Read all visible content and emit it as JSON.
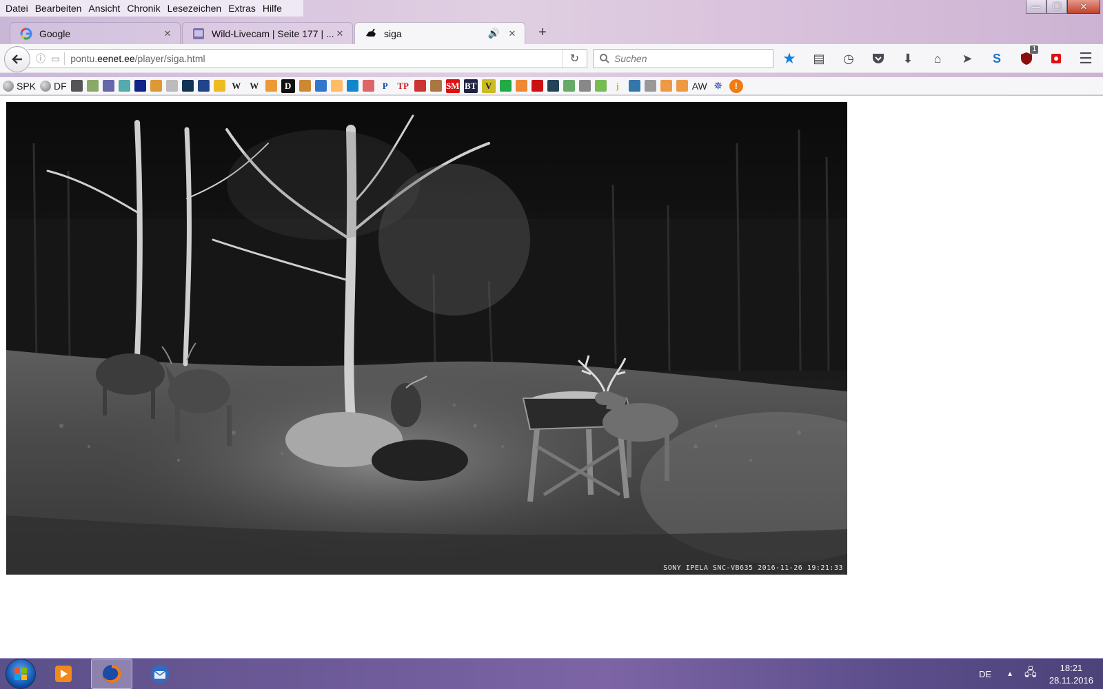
{
  "menubar": {
    "items": [
      "Datei",
      "Bearbeiten",
      "Ansicht",
      "Chronik",
      "Lesezeichen",
      "Extras",
      "Hilfe"
    ]
  },
  "window_controls": {
    "minimize": "—",
    "maximize": "❐",
    "close": "✕"
  },
  "tabs": [
    {
      "title": "Google",
      "favicon": "google-icon",
      "active": false
    },
    {
      "title": "Wild-Livecam | Seite 177 | ...",
      "favicon": "forum-icon",
      "active": false
    },
    {
      "title": "siga",
      "favicon": "boar-icon",
      "active": true,
      "audio": true
    }
  ],
  "new_tab_label": "+",
  "navbar": {
    "url_prefix": "pontu.",
    "url_host": "eenet.ee",
    "url_path": "/player/siga.html",
    "search_placeholder": "Suchen",
    "addon_badge": "1"
  },
  "bookmarks": {
    "spk": "SPK",
    "df": "DF",
    "aw": "AW",
    "icons": [
      "ob",
      "dgf",
      "img",
      "sph",
      "nt",
      "sky",
      "map",
      "ard",
      "news",
      "smiley",
      "W",
      "W",
      "gold",
      "D",
      "book",
      "tr",
      "mx",
      "bdu",
      "x",
      "P",
      "TP",
      "plane",
      "lion",
      "SM",
      "BT",
      "V",
      "grn",
      "arr",
      "yt",
      "mt",
      "blk",
      "glb",
      "bar",
      "j",
      "vk",
      "eye",
      "sun",
      "sun",
      "wheel",
      "warn"
    ]
  },
  "video": {
    "camera_stamp": "SONY IPELA SNC-VB635   2016-11-26 19:21:33"
  },
  "taskbar": {
    "language": "DE",
    "time": "18:21",
    "date": "28.11.2016"
  },
  "colors": {
    "chrome_tint": "#d7c3df",
    "taskbar": "#6d5a98",
    "bookmark_star": "#1a7fd6"
  }
}
